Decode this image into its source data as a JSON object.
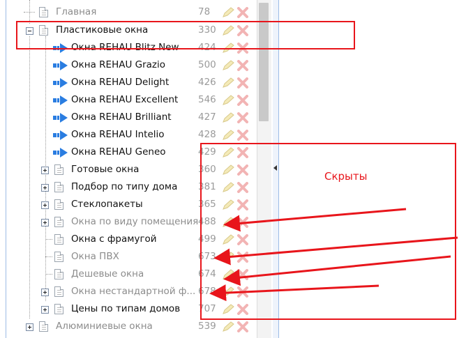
{
  "tree": {
    "rows": [
      {
        "label": "Главная",
        "num": "78",
        "hidden": true
      },
      {
        "label": "Пластиковые окна",
        "num": "330",
        "hidden": false
      },
      {
        "label": "Окна REHAU Blitz New",
        "num": "424",
        "hidden": false
      },
      {
        "label": "Окна REHAU Grazio",
        "num": "500",
        "hidden": false
      },
      {
        "label": "Окна REHAU Delight",
        "num": "426",
        "hidden": false
      },
      {
        "label": "Окна REHAU Excellent",
        "num": "546",
        "hidden": false
      },
      {
        "label": "Окна REHAU Brilliant",
        "num": "427",
        "hidden": false
      },
      {
        "label": "Окна REHAU Intelio",
        "num": "428",
        "hidden": false
      },
      {
        "label": "Окна REHAU Geneo",
        "num": "429",
        "hidden": false
      },
      {
        "label": "Готовые окна",
        "num": "360",
        "hidden": false
      },
      {
        "label": "Подбор по типу дома",
        "num": "381",
        "hidden": false
      },
      {
        "label": "Стеклопакеты",
        "num": "365",
        "hidden": false
      },
      {
        "label": "Окна по виду помещения",
        "num": "488",
        "hidden": true
      },
      {
        "label": "Окна с фрамугой",
        "num": "499",
        "hidden": false
      },
      {
        "label": "Окна ПВХ",
        "num": "673",
        "hidden": true
      },
      {
        "label": "Дешевые окна",
        "num": "674",
        "hidden": true
      },
      {
        "label": "Окна нестандартной ф...",
        "num": "678",
        "hidden": true
      },
      {
        "label": "Цены по типам домов",
        "num": "707",
        "hidden": false
      },
      {
        "label": "Алюминиевые окна",
        "num": "539",
        "hidden": true
      }
    ]
  },
  "annotation": {
    "label": "Скрыты"
  },
  "colors": {
    "annotation": "#e8151b",
    "arrow_icon": "#2a7de1"
  },
  "icons": {
    "edit": "pencil-icon",
    "delete": "delete-icon",
    "page": "page-icon",
    "child": "blue-arrow-icon"
  }
}
